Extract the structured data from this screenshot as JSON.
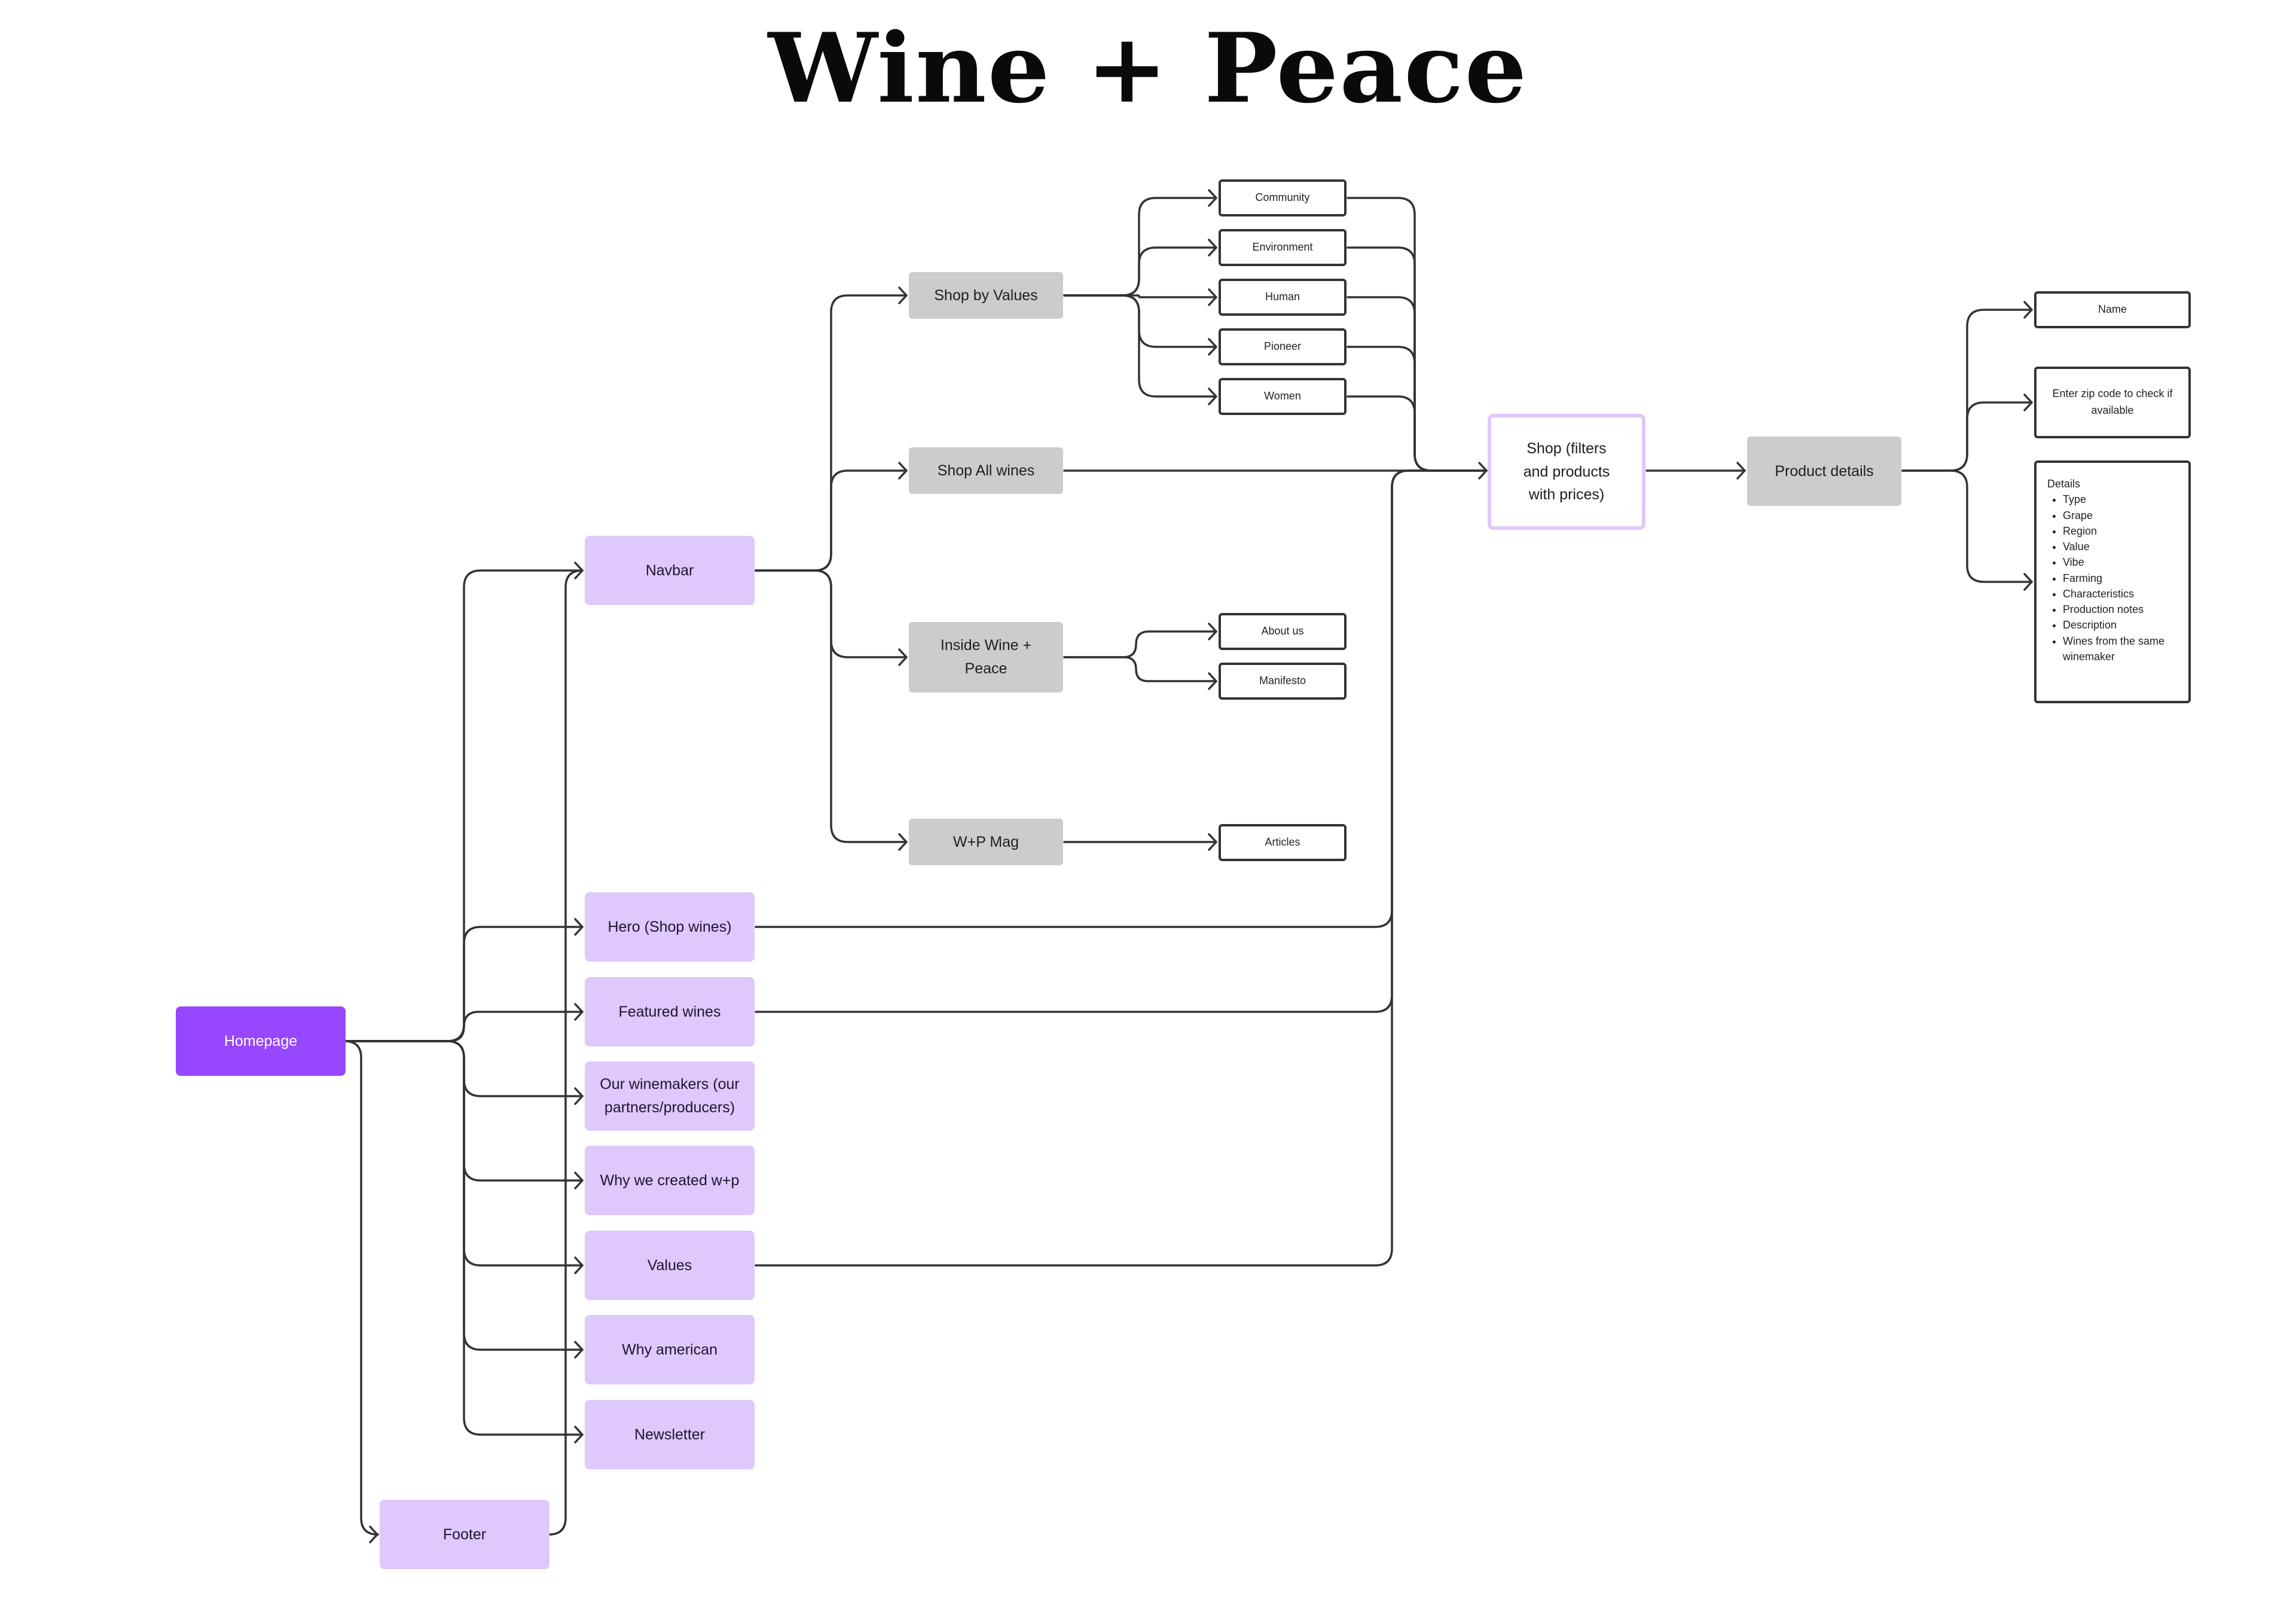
{
  "title": "Wine + Peace",
  "colors": {
    "homepage": "#9747ff",
    "section": "#dfc8fc",
    "nav_item": "#cccccc",
    "connector": "#333333",
    "outline": "#333333"
  },
  "nodes": {
    "homepage": "Homepage",
    "navbar": "Navbar",
    "hero": "Hero (Shop wines)",
    "featured": "Featured wines",
    "winemakers": "Our winemakers (our partners/producers)",
    "why_created": "Why we created w+p",
    "values": "Values",
    "why_american": "Why american",
    "newsletter": "Newsletter",
    "footer": "Footer",
    "shop_by_values": "Shop by Values",
    "shop_all": "Shop All wines",
    "inside": "Inside Wine + Peace",
    "mag": "W+P Mag",
    "community": "Community",
    "environment": "Environment",
    "human": "Human",
    "pioneer": "Pioneer",
    "women": "Women",
    "about": "About us",
    "manifesto": "Manifesto",
    "articles": "Articles",
    "shop": "Shop (filters and products with prices)",
    "product_details": "Product details",
    "name": "Name",
    "zip": "Enter zip code to check if available",
    "details": {
      "heading": "Details",
      "items": [
        "Type",
        "Grape",
        "Region",
        "Value",
        "Vibe",
        "Farming",
        "Characteristics",
        "Production notes",
        "Description",
        "Wines from the same winemaker"
      ]
    }
  },
  "edges": [
    [
      "homepage",
      "navbar"
    ],
    [
      "homepage",
      "hero"
    ],
    [
      "homepage",
      "featured"
    ],
    [
      "homepage",
      "winemakers"
    ],
    [
      "homepage",
      "why_created"
    ],
    [
      "homepage",
      "values"
    ],
    [
      "homepage",
      "why_american"
    ],
    [
      "homepage",
      "newsletter"
    ],
    [
      "homepage",
      "footer"
    ],
    [
      "footer",
      "navbar"
    ],
    [
      "navbar",
      "shop_by_values"
    ],
    [
      "navbar",
      "shop_all"
    ],
    [
      "navbar",
      "inside"
    ],
    [
      "navbar",
      "mag"
    ],
    [
      "shop_by_values",
      "community"
    ],
    [
      "shop_by_values",
      "environment"
    ],
    [
      "shop_by_values",
      "human"
    ],
    [
      "shop_by_values",
      "pioneer"
    ],
    [
      "shop_by_values",
      "women"
    ],
    [
      "inside",
      "about"
    ],
    [
      "inside",
      "manifesto"
    ],
    [
      "mag",
      "articles"
    ],
    [
      "community",
      "shop"
    ],
    [
      "environment",
      "shop"
    ],
    [
      "human",
      "shop"
    ],
    [
      "pioneer",
      "shop"
    ],
    [
      "women",
      "shop"
    ],
    [
      "shop_all",
      "shop"
    ],
    [
      "hero",
      "shop"
    ],
    [
      "featured",
      "shop"
    ],
    [
      "values",
      "shop"
    ],
    [
      "shop",
      "product_details"
    ],
    [
      "product_details",
      "name"
    ],
    [
      "product_details",
      "zip"
    ],
    [
      "product_details",
      "details"
    ]
  ]
}
